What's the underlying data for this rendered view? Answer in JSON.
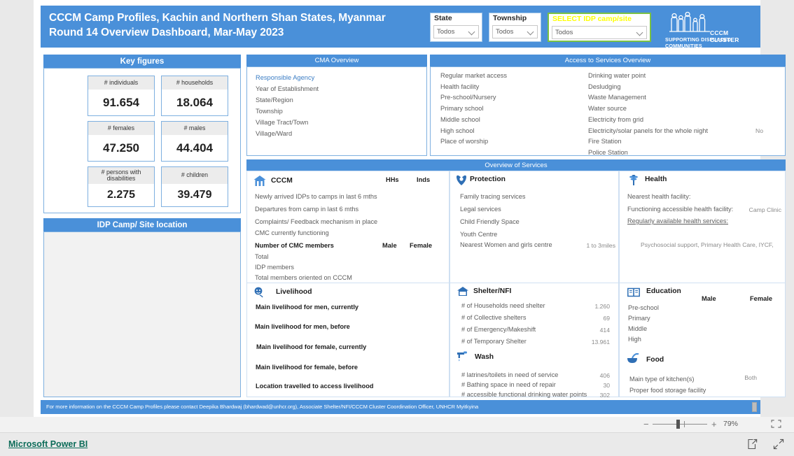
{
  "header": {
    "title_line1": "CCCM Camp Profiles, Kachin and Northern Shan States, Myanmar",
    "title_line2": "Round 14 Overview Dashboard, Mar-May 2023",
    "slicers": [
      {
        "label": "State",
        "value": "Todos"
      },
      {
        "label": "Township",
        "value": "Todos"
      },
      {
        "label": "SELECT IDP camp/site",
        "value": "Todos"
      }
    ],
    "logo": {
      "line1": "CCCM CLUSTER",
      "line2": "SUPPORTING DISPLACED COMMUNITIES"
    },
    "accent_blue": "#4a90d9",
    "highlight_green": "#7ac143",
    "highlight_yellow": "#ffff00"
  },
  "key_figures": {
    "title": "Key figures",
    "cards": [
      {
        "label": "# individuals",
        "value": "91.654"
      },
      {
        "label": "# households",
        "value": "18.064"
      },
      {
        "label": "# females",
        "value": "47.250"
      },
      {
        "label": "# males",
        "value": "44.404"
      },
      {
        "label": "# persons with disabilities",
        "value": "2.275"
      },
      {
        "label": "# children",
        "value": "39.479"
      }
    ]
  },
  "map_panel": {
    "title": "IDP Camp/ Site location"
  },
  "cma_overview": {
    "title": "CMA Overview",
    "items": [
      "Responsible Agency",
      "Year of Establishment",
      "State/Region",
      "Township",
      "Village Tract/Town",
      "Village/Ward"
    ]
  },
  "access_to_services": {
    "title": "Access to Services Overview",
    "column1": [
      {
        "label": "Regular market access",
        "value": ""
      },
      {
        "label": "Health facility",
        "value": ""
      },
      {
        "label": "Pre-school/Nursery",
        "value": ""
      },
      {
        "label": "Primary school",
        "value": ""
      },
      {
        "label": "Middle school",
        "value": ""
      },
      {
        "label": "High school",
        "value": ""
      },
      {
        "label": "Place of worship",
        "value": ""
      }
    ],
    "column2": [
      {
        "label": "Drinking water point",
        "value": ""
      },
      {
        "label": "Desludging",
        "value": ""
      },
      {
        "label": "Waste Management",
        "value": ""
      },
      {
        "label": "Water source",
        "value": ""
      },
      {
        "label": "Electricity from grid",
        "value": ""
      },
      {
        "label": "Electricity/solar panels for the whole night",
        "value": "No"
      },
      {
        "label": "Fire Station",
        "value": ""
      },
      {
        "label": "Police Station",
        "value": ""
      }
    ]
  },
  "overview_of_services": {
    "title": "Overview of Services",
    "cccm": {
      "title": "CCCM",
      "icon": "camp-house-icon",
      "col_hh": "HHs",
      "col_inds": "Inds",
      "col_male": "Male",
      "col_female": "Female",
      "rows": [
        "Newly arrived IDPs to camps in last 6 mths",
        "Departures from camp in last 6 mths",
        "Complaints/ Feedback mechanism in place",
        "CMC currently functioning"
      ],
      "members_header": "Number of CMC members",
      "member_rows": [
        "Total",
        "IDP members",
        "Total members oriented on CCCM"
      ]
    },
    "protection": {
      "title": "Protection",
      "icon": "protection-hands-icon",
      "rows": [
        {
          "label": "Family tracing services",
          "value": ""
        },
        {
          "label": "Legal services",
          "value": ""
        },
        {
          "label": "Child Friendly Space",
          "value": ""
        },
        {
          "label": "Youth Centre",
          "value": ""
        },
        {
          "label": "Nearest Women and girls centre",
          "value": "1 to 3miles"
        }
      ]
    },
    "health": {
      "title": "Health",
      "icon": "health-caduceus-icon",
      "rows": [
        {
          "label": "Nearest health facility:",
          "value": ""
        },
        {
          "label": "Functioning accessible health facility:",
          "value": "Camp Clinic"
        },
        {
          "label": "Regularly available health services:",
          "value": ""
        }
      ],
      "services_value": "Psychosocial support, Primary Health Care, IYCF,"
    },
    "livelihood": {
      "title": "Livelihood",
      "icon": "livelihood-person-icon",
      "rows": [
        "Main livelihood for men, currently",
        "Main livelihood for men, before",
        "Main livelihood for female, currently",
        "Main livelihood for female, before",
        "Location travelled to access livelihood"
      ]
    },
    "shelter": {
      "title": "Shelter/NFI",
      "icon": "shelter-home-icon",
      "rows": [
        {
          "label": "# of Households need shelter",
          "value": "1.260"
        },
        {
          "label": "# of Collective shelters",
          "value": "69"
        },
        {
          "label": "# of Emergency/Makeshift",
          "value": "414"
        },
        {
          "label": "# of Temporary Shelter",
          "value": "13.961"
        }
      ]
    },
    "wash": {
      "title": "Wash",
      "icon": "water-tap-icon",
      "rows": [
        {
          "label": "# latrines/toilets in need of service",
          "value": "406"
        },
        {
          "label": "# Bathing space in need of repair",
          "value": "30"
        },
        {
          "label": "# accessible functional drinking water points",
          "value": "302"
        }
      ]
    },
    "education": {
      "title": "Education",
      "icon": "education-book-icon",
      "col_male": "Male",
      "col_female": "Female",
      "rows": [
        "Pre-school",
        "Primary",
        "Middle",
        "High"
      ]
    },
    "food": {
      "title": "Food",
      "icon": "food-bowl-icon",
      "rows": [
        {
          "label": "Main type of kitchen(s)",
          "value": "Both"
        },
        {
          "label": "Proper food storage facility",
          "value": ""
        }
      ]
    }
  },
  "footer": {
    "text": "For more information on the CCCM Camp Profiles please contact Deepika Bhardwaj (bhardwad@unhcr.org), Associate Shelter/NFI/CCCM Cluster Coordination Officer, UNHCR Myitkyina"
  },
  "zoom_toolbar": {
    "minus": "−",
    "plus": "+",
    "percent": "79%"
  },
  "status_bar": {
    "link": "Microsoft Power BI"
  }
}
